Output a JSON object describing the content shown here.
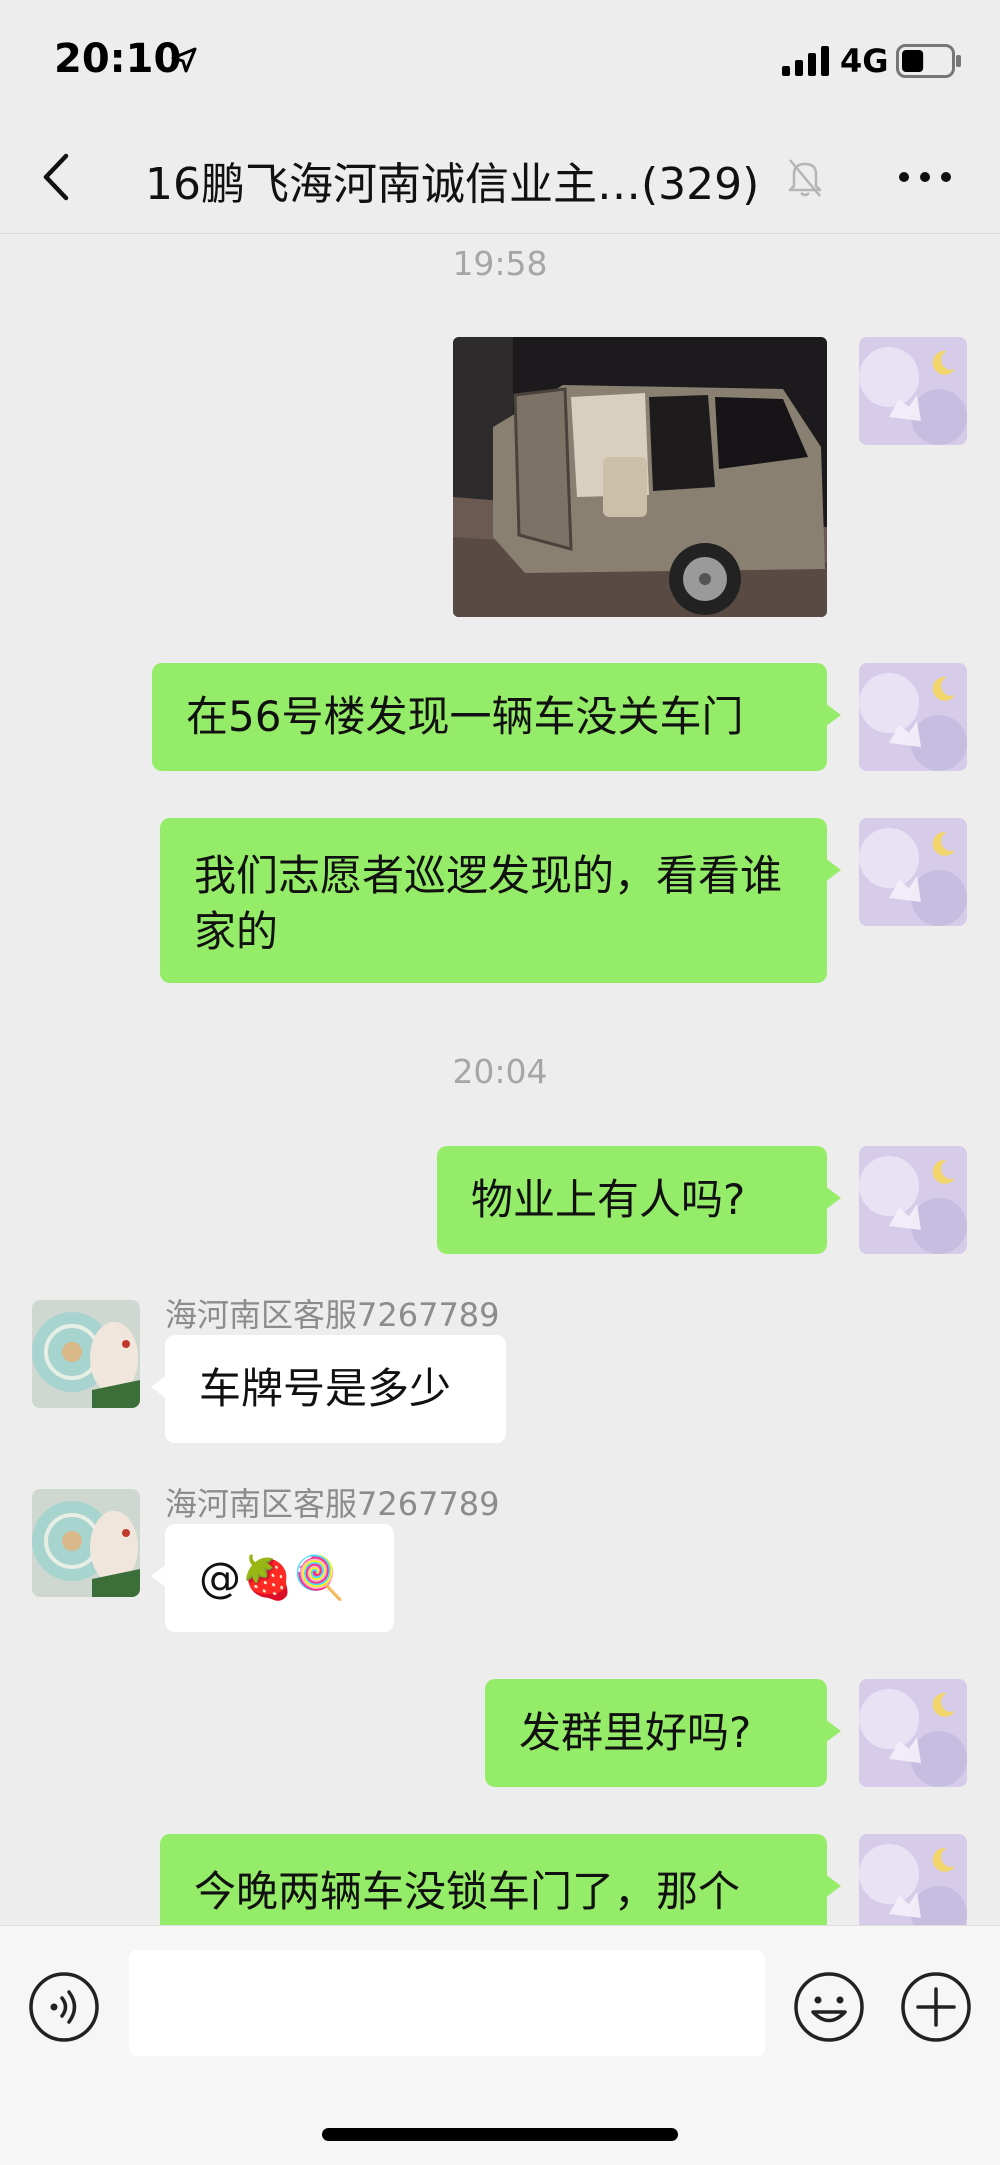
{
  "status_bar": {
    "time": "20:10",
    "network": "4G",
    "battery_level": 0.45
  },
  "nav": {
    "title": "16鹏飞海河南诚信业主…(329)"
  },
  "messages": {
    "time1": "19:58",
    "m2": "在56号楼发现一辆车没关车门",
    "m3": "我们志愿者巡逻发现的，看看谁家的",
    "time2": "20:04",
    "m4": "物业上有人吗?",
    "sender1": "海河南区客服7267789",
    "m5": "车牌号是多少",
    "sender2": "海河南区客服7267789",
    "m6": "@🍓🍭",
    "m7": "发群里好吗?",
    "m8": "今晚两辆车没锁车门了，那个"
  },
  "input": {
    "value": ""
  },
  "colors": {
    "outgoing_bubble": "#95ec69",
    "incoming_bubble": "#ffffff",
    "background": "#ededed"
  }
}
